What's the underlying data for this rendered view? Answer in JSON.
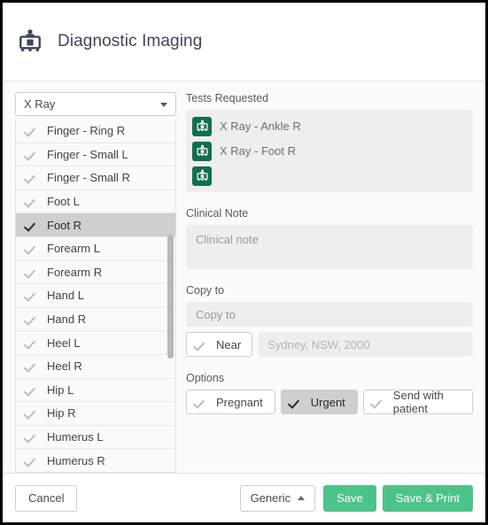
{
  "header": {
    "title": "Diagnostic Imaging",
    "icon": "xray-machine-icon"
  },
  "left_panel": {
    "modality_select": {
      "value": "X Ray",
      "icon": "chevron-down-icon"
    },
    "region_items": [
      {
        "label": "Finger - Ring R",
        "selected": false
      },
      {
        "label": "Finger - Small L",
        "selected": false
      },
      {
        "label": "Finger - Small R",
        "selected": false
      },
      {
        "label": "Foot L",
        "selected": false
      },
      {
        "label": "Foot R",
        "selected": true
      },
      {
        "label": "Forearm L",
        "selected": false
      },
      {
        "label": "Forearm R",
        "selected": false
      },
      {
        "label": "Hand L",
        "selected": false
      },
      {
        "label": "Hand R",
        "selected": false
      },
      {
        "label": "Heel L",
        "selected": false
      },
      {
        "label": "Heel R",
        "selected": false
      },
      {
        "label": "Hip L",
        "selected": false
      },
      {
        "label": "Hip R",
        "selected": false
      },
      {
        "label": "Humerus L",
        "selected": false
      },
      {
        "label": "Humerus R",
        "selected": false
      }
    ]
  },
  "tests_requested": {
    "label": "Tests Requested",
    "items": [
      {
        "label": "X Ray - Ankle R",
        "icon": "xray-machine-icon"
      },
      {
        "label": "X Ray - Foot R",
        "icon": "xray-machine-icon"
      },
      {
        "label": "",
        "icon": "xray-machine-icon"
      }
    ]
  },
  "clinical_note": {
    "label": "Clinical Note",
    "value": "",
    "placeholder": "Clinical note"
  },
  "copy_to": {
    "label": "Copy to",
    "value": "",
    "placeholder": "Copy to",
    "near_button": {
      "label": "Near",
      "active": false,
      "icon": "check-icon"
    },
    "location": {
      "value": "",
      "placeholder": "Sydney, NSW, 2000"
    }
  },
  "options": {
    "label": "Options",
    "buttons": [
      {
        "label": "Pregnant",
        "active": false,
        "icon": "check-icon"
      },
      {
        "label": "Urgent",
        "active": true,
        "icon": "check-icon"
      },
      {
        "label": "Send with patient",
        "active": false,
        "icon": "check-icon"
      }
    ]
  },
  "footer": {
    "cancel_label": "Cancel",
    "generic_label": "Generic",
    "generic_icon": "chevron-up-icon",
    "save_label": "Save",
    "save_print_label": "Save & Print"
  },
  "colors": {
    "accent_green": "#4cc38a",
    "badge_green": "#11704b",
    "selected_gray": "#cfcfcf",
    "field_gray": "#eeeeee"
  }
}
